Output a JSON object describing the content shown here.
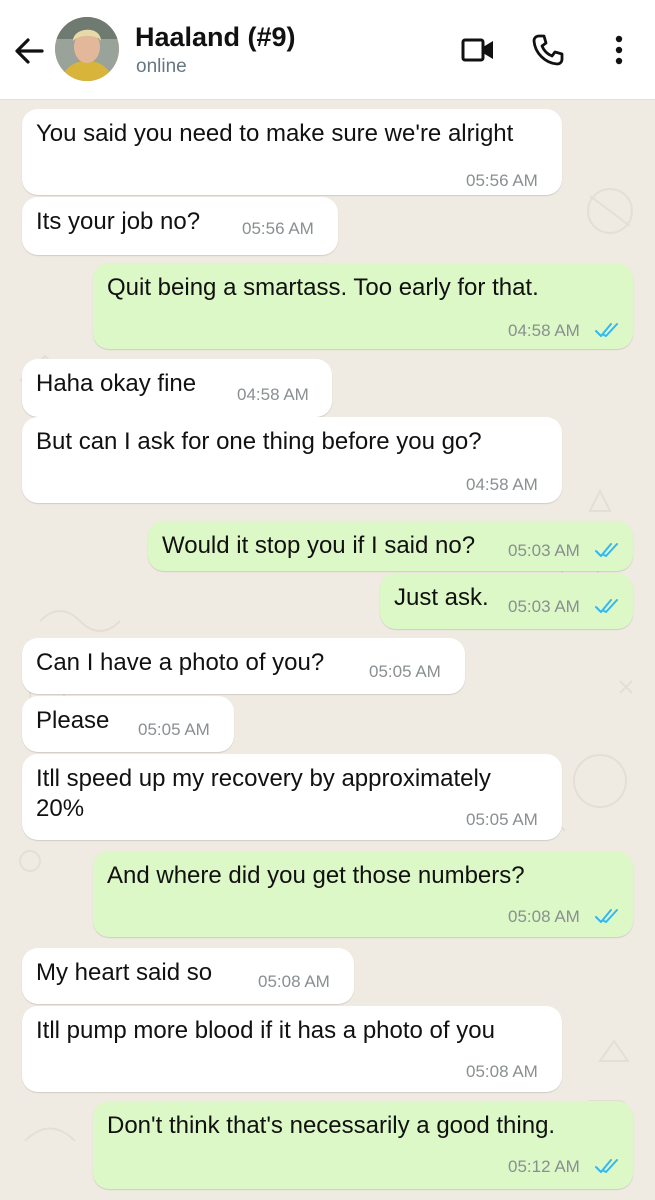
{
  "header": {
    "contact_name": "Haaland (#9)",
    "status": "online",
    "icons": [
      "back-arrow-icon",
      "video-call-icon",
      "voice-call-icon",
      "more-options-icon"
    ]
  },
  "colors": {
    "incoming": "#ffffff",
    "outgoing": "#dcf8c6",
    "read_tick": "#34b7f1",
    "chat_bg": "#efeae2"
  },
  "messages": [
    {
      "dir": "in",
      "text": "You said you need to make sure we're alright",
      "time": "05:56 AM"
    },
    {
      "dir": "in",
      "text": "Its your job no?",
      "time": "05:56 AM"
    },
    {
      "dir": "out",
      "text": "Quit being a smartass. Too early for that.",
      "time": "04:58 AM",
      "status": "read"
    },
    {
      "dir": "in",
      "text": "Haha okay fine",
      "time": "04:58 AM"
    },
    {
      "dir": "in",
      "text": "But can I ask for one thing before you go?",
      "time": "04:58 AM"
    },
    {
      "dir": "out",
      "text": "Would it stop you if I said no?",
      "time": "05:03 AM",
      "status": "read"
    },
    {
      "dir": "out",
      "text": "Just ask.",
      "time": "05:03 AM",
      "status": "read"
    },
    {
      "dir": "in",
      "text": "Can I have a photo of you?",
      "time": "05:05 AM"
    },
    {
      "dir": "in",
      "text": "Please",
      "time": "05:05 AM"
    },
    {
      "dir": "in",
      "text": "Itll speed up my recovery by approximately\n20%",
      "time": "05:05 AM"
    },
    {
      "dir": "out",
      "text": "And where did you get those numbers?",
      "time": "05:08 AM",
      "status": "read"
    },
    {
      "dir": "in",
      "text": "My heart said so",
      "time": "05:08 AM"
    },
    {
      "dir": "in",
      "text": "Itll pump more blood if it has a photo of you",
      "time": "05:08 AM"
    },
    {
      "dir": "out",
      "text": "Don't think that's necessarily a good thing.",
      "time": "05:12 AM",
      "status": "read"
    }
  ]
}
